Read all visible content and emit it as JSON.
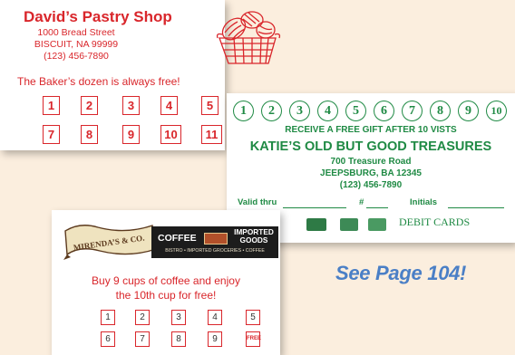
{
  "pastry_card": {
    "title": "David’s Pastry Shop",
    "address": [
      "1000 Bread Street",
      "BISCUIT, NA 99999",
      "(123) 456-7890"
    ],
    "tagline": "The Baker’s dozen is always free!",
    "punch_numbers": [
      "1",
      "2",
      "3",
      "4",
      "5",
      "7",
      "8",
      "9",
      "10",
      "11"
    ],
    "accent_color": "#d9262b",
    "illustration": "bread-basket-icon"
  },
  "katie_card": {
    "number_circles": [
      "1",
      "2",
      "3",
      "4",
      "5",
      "6",
      "7",
      "8",
      "9",
      "10"
    ],
    "offer": "RECEIVE A FREE GIFT AFTER 10 VISTS",
    "name": "KATIE’S OLD BUT GOOD TREASURES",
    "address": [
      "700 Treasure Road",
      "JEEPSBURG, BA 12345",
      "(123) 456-7890"
    ],
    "form": {
      "valid_thru": "Valid thru",
      "hash": "#",
      "initials": "Initials"
    },
    "payment_icons": [
      "card-icon",
      "card-icon",
      "card-icon",
      "discover-card-icon"
    ],
    "debit_text": "DEBIT CARDS",
    "accent_color": "#1f8a44"
  },
  "coffee_card": {
    "banner_name": "MIRENDA’S & CO.",
    "coffee_word": "COFFEE",
    "imported_goods": "IMPORTED GOODS",
    "banner_sub": "BISTRO • IMPORTED GROCERIES • COFFEE",
    "offer_lines": [
      "Buy 9 cups of coffee and enjoy",
      "the 10th cup for free!"
    ],
    "punch_numbers": [
      "1",
      "2",
      "3",
      "4",
      "5",
      "6",
      "7",
      "8",
      "9",
      "FREE"
    ]
  },
  "see_page": "See Page 104!"
}
